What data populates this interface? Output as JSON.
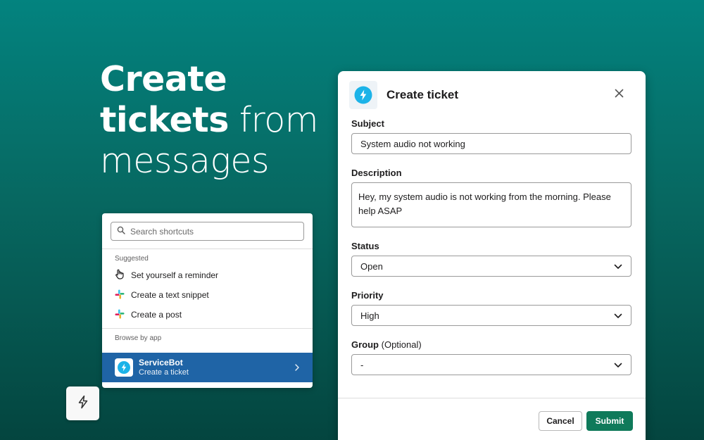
{
  "hero": {
    "line1": "Create",
    "line2_bold": "tickets",
    "line2_light": " from",
    "line3": "messages"
  },
  "shortcuts": {
    "search_placeholder": "Search shortcuts",
    "suggested_label": "Suggested",
    "items": [
      {
        "label": "Set yourself a reminder",
        "icon": "hand-icon"
      },
      {
        "label": "Create a text snippet",
        "icon": "slack-icon"
      },
      {
        "label": "Create a post",
        "icon": "slack-icon"
      }
    ],
    "browse_label": "Browse by app",
    "app": {
      "name": "ServiceBot",
      "action": "Create a ticket",
      "icon": "lightning-icon"
    }
  },
  "modal": {
    "title": "Create ticket",
    "fields": {
      "subject": {
        "label": "Subject",
        "value": "System audio not working"
      },
      "description": {
        "label": "Description",
        "value": "Hey, my system audio is not working from the morning. Please help ASAP"
      },
      "status": {
        "label": "Status",
        "value": "Open"
      },
      "priority": {
        "label": "Priority",
        "value": "High"
      },
      "group": {
        "label": "Group",
        "optional": "(Optional)",
        "value": "-"
      }
    },
    "buttons": {
      "cancel": "Cancel",
      "submit": "Submit"
    }
  },
  "colors": {
    "accent_blue": "#1f64a6",
    "submit_green": "#0f7a5a",
    "bolt_cyan": "#1cb3e8"
  }
}
